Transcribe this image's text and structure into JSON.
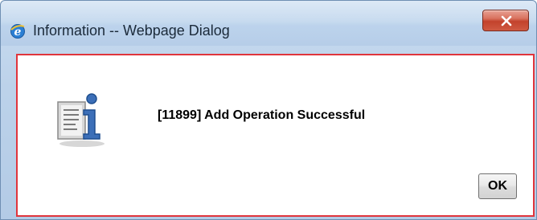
{
  "window": {
    "title": "Information -- Webpage Dialog",
    "icon": "internet-explorer-icon"
  },
  "dialog": {
    "message": "[11899] Add Operation Successful",
    "icon": "information-icon",
    "ok_label": "OK"
  },
  "colors": {
    "content_border": "#e0353c",
    "close_button": "#c3422c",
    "titlebar": "#c8dbef"
  }
}
